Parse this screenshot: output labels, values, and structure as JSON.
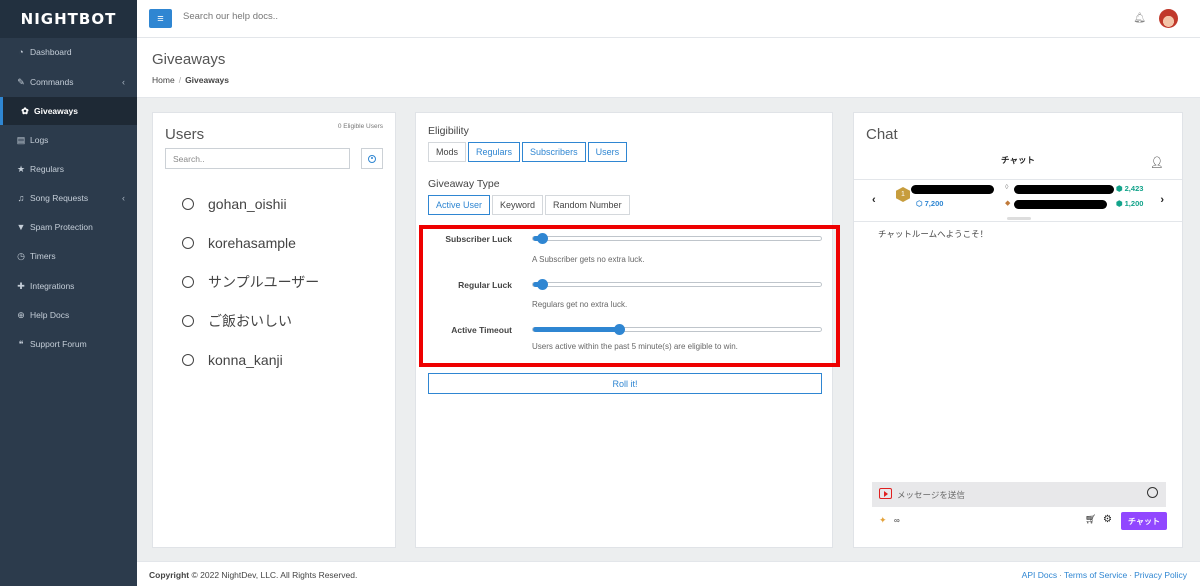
{
  "app": {
    "logo": "NIGHTBOT"
  },
  "sidebar": {
    "items": [
      {
        "label": "Dashboard",
        "icon": "dashboard-icon",
        "glyph": "◔"
      },
      {
        "label": "Commands",
        "icon": "magic-wand-icon",
        "glyph": "✎"
      },
      {
        "label": "Giveaways",
        "icon": "gift-icon",
        "glyph": "✿"
      },
      {
        "label": "Logs",
        "icon": "logs-icon",
        "glyph": "▤"
      },
      {
        "label": "Regulars",
        "icon": "star-icon",
        "glyph": "★"
      },
      {
        "label": "Song Requests",
        "icon": "music-icon",
        "glyph": "♫"
      },
      {
        "label": "Spam Protection",
        "icon": "shield-icon",
        "glyph": "▼"
      },
      {
        "label": "Timers",
        "icon": "clock-icon",
        "glyph": "◷"
      },
      {
        "label": "Integrations",
        "icon": "puzzle-icon",
        "glyph": "✚"
      },
      {
        "label": "Help Docs",
        "icon": "globe-icon",
        "glyph": "⊕"
      },
      {
        "label": "Support Forum",
        "icon": "comments-icon",
        "glyph": "❝"
      }
    ]
  },
  "topbar": {
    "search_placeholder": "Search our help docs.."
  },
  "header": {
    "title": "Giveaways",
    "breadcrumb_home": "Home",
    "breadcrumb_current": "Giveaways"
  },
  "users_panel": {
    "title": "Users",
    "eligible_count": "0 Eligible Users",
    "search_placeholder": "Search..",
    "users": [
      "gohan_oishii",
      "korehasample",
      "サンプルユーザー",
      "ご飯おいしい",
      "konna_kanji"
    ]
  },
  "eligibility": {
    "title": "Eligibility",
    "options": [
      {
        "label": "Mods",
        "selected": false
      },
      {
        "label": "Regulars",
        "selected": true
      },
      {
        "label": "Subscribers",
        "selected": true
      },
      {
        "label": "Users",
        "selected": true
      }
    ],
    "type_title": "Giveaway Type",
    "types": [
      {
        "label": "Active User",
        "selected": true
      },
      {
        "label": "Keyword",
        "selected": false
      },
      {
        "label": "Random Number",
        "selected": false
      }
    ],
    "sliders": [
      {
        "label": "Subscriber Luck",
        "value": 0.03,
        "help": "A Subscriber gets no extra luck."
      },
      {
        "label": "Regular Luck",
        "value": 0.03,
        "help": "Regulars get no extra luck."
      },
      {
        "label": "Active Timeout",
        "value": 0.3,
        "help": "Users active within the past 5 minute(s) are eligible to win."
      }
    ],
    "roll_label": "Roll it!"
  },
  "chat": {
    "title": "Chat",
    "header": "チャット",
    "points_1": "7,200",
    "points_2": "2,423",
    "points_3": "1,200",
    "welcome": "チャットルームへようこそ！",
    "input_placeholder": "メッセージを送信",
    "infinity": "∞",
    "send_label": "チャット"
  },
  "footer": {
    "copyright_label": "Copyright",
    "copyright_text": "© 2022 NightDev, LLC. All Rights Reserved.",
    "links": [
      "API Docs",
      "Terms of Service",
      "Privacy Policy"
    ]
  },
  "colors": {
    "accent": "#2f86d2",
    "sidebar": "#2c3b4c",
    "highlight": "#ee0000",
    "twitch": "#9147ff"
  }
}
